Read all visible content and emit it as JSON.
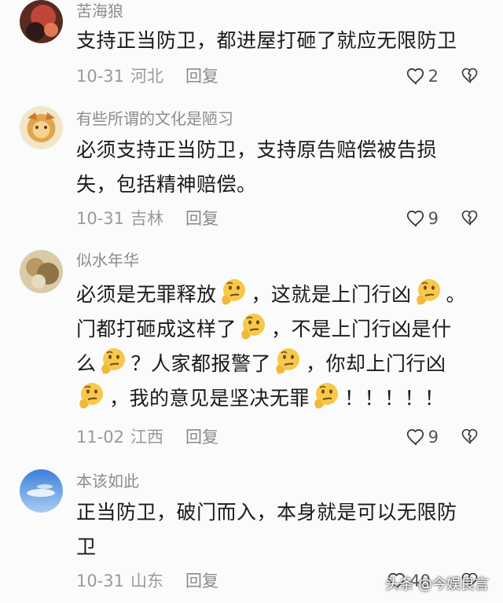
{
  "comments": [
    {
      "username": "苦海狼",
      "lines": [
        [
          "支持正当防卫，都进屋打砸了就应无限防卫"
        ]
      ],
      "date": "10-31",
      "location": "河北",
      "reply_label": "回复",
      "likes": "2"
    },
    {
      "username": "有些所谓的文化是陋习",
      "lines": [
        [
          "必须支持正当防卫，支持原告赔偿被告损"
        ],
        [
          "失，包括精神赔偿。"
        ]
      ],
      "date": "10-31",
      "location": "吉林",
      "reply_label": "回复",
      "likes": "9"
    },
    {
      "username": "似水年华",
      "lines": [
        [
          "必须是无罪释放",
          "，这就是上门行凶",
          "。"
        ],
        [
          "门都打砸成这样了",
          "，不是上门行凶是什"
        ],
        [
          "么",
          "？人家都报警了",
          "，你却上门行凶"
        ],
        [
          "",
          "，我的意见是坚决无罪",
          "！！！！！"
        ]
      ],
      "date": "11-02",
      "location": "江西",
      "reply_label": "回复",
      "likes": "9"
    },
    {
      "username": "本该如此",
      "lines": [
        [
          "正当防卫，破门而入，本身就是可以无限防"
        ],
        [
          "卫"
        ]
      ],
      "date": "10-31",
      "location": "山东",
      "reply_label": "回复",
      "likes": "40"
    }
  ],
  "icons": {
    "like": "heart-outline-icon",
    "dislike": "broken-heart-icon",
    "emoji": "thinking-face-emoji-icon"
  },
  "watermark": "头条 @今娱良言"
}
